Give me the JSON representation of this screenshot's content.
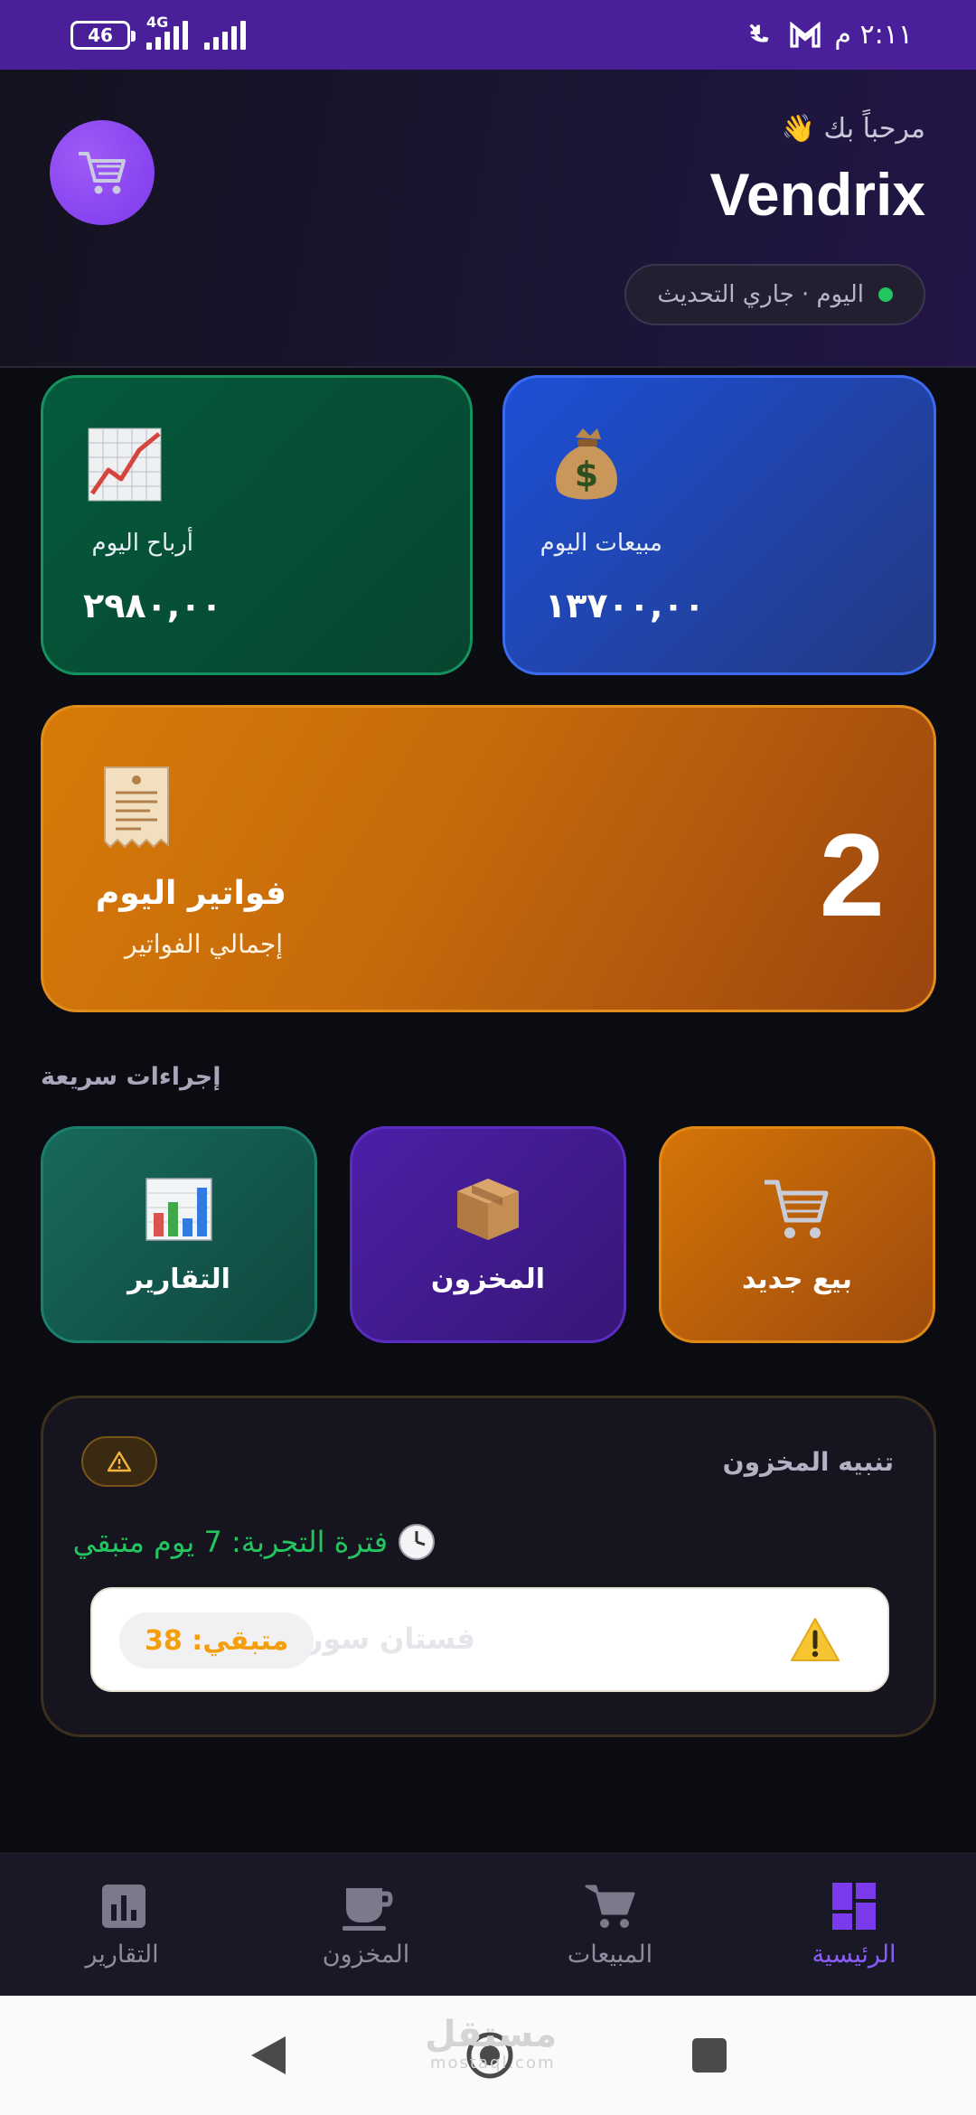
{
  "status_bar": {
    "battery": "46",
    "network": "4G",
    "time": "٢:١١ م"
  },
  "header": {
    "greeting": "مرحباً بك 👋",
    "app_name": "Vendrix",
    "status_text": "اليوم · جاري التحديث",
    "status_color": "#22c55e"
  },
  "stats": {
    "profit_label": "أرباح اليوم",
    "profit_value": "٢٩٨٠,٠٠",
    "sales_label": "مبيعات اليوم",
    "sales_value": "١٣٧٠٠,٠٠",
    "invoices_title": "فواتير اليوم",
    "invoices_sub": "إجمالي الفواتير",
    "invoices_count": "2"
  },
  "quick_actions": {
    "title": "إجراءات سريعة",
    "reports": "التقارير",
    "inventory": "المخزون",
    "new_sale": "بيع جديد"
  },
  "alert": {
    "title": "تنبيه المخزون",
    "trial_text": "فترة التجربة: 7 يوم متبقي",
    "product_name": "فستان سورية",
    "remaining": "متبقي: 38"
  },
  "bottom_nav": {
    "reports": "التقارير",
    "inventory": "المخزون",
    "sales": "المبيعات",
    "home": "الرئيسية"
  },
  "watermark": {
    "text": "مستقل",
    "sub": "mostaql.com"
  },
  "colors": {
    "accent": "#8b5cf6",
    "status_bar": "#4a1f9a",
    "profit_card": "#045a3c",
    "sales_card": "#1d4fd6",
    "invoices_card": "#d77a08",
    "warning": "#f59e0b"
  }
}
